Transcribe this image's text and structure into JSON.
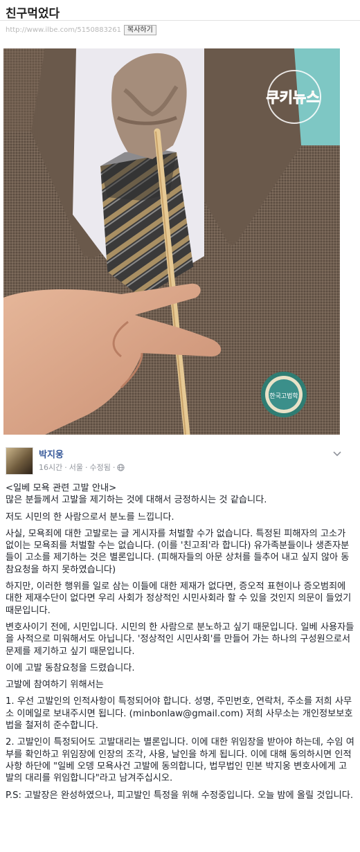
{
  "page": {
    "title": "친구먹었다",
    "url": "http://www.ilbe.com/5150883261",
    "copy_button": "복사하기"
  },
  "photo": {
    "alt": "",
    "watermark_text": "쿠키뉴스",
    "badge_text": "한국고법학"
  },
  "post": {
    "author": "박지웅",
    "time": "16시간",
    "location": "서울",
    "edited": "수정됨",
    "separator": "·",
    "paragraphs": [
      "<일베 모욕 관련 고발 안내>",
      "많은 분들께서 고발을 제기하는 것에 대해서 긍정하시는 것 같습니다.",
      "저도 시민의 한 사람으로서 분노를 느낍니다.",
      "사실, 모욕죄에 대한 고발로는 글 게시자를 처벌할 수가 없습니다. 특정된 피해자의 고소가 없이는 모욕죄를 처벌할 수는 없습니다. (이를 '친고죄'라 합니다) 유가족분들이나 생존자분들이 고소를 제기하는 것은 별론입니다. (피해자들의 아문 상처를 들추어 내고 싶지 않아 동참요청을 하지 못하였습니다)",
      "하지만, 이러한 행위를 일로 삼는 이들에 대한 제재가 없다면, 증오적 표현이나 증오범죄에 대한 제재수단이 없다면 우리 사회가 정상적인 시민사회라 할 수 있을 것인지 의문이 들었기 때문입니다.",
      "변호사이기 전에, 시민입니다. 시민의 한 사람으로 분노하고 싶기 때문입니다. 일베 사용자들을 사적으로 미워해서도 아닙니다. '정상적인 시민사회'를 만들어 가는 하나의 구성원으로서 문제를 제기하고 싶기 때문입니다.",
      "이에 고발 동참요청을 드렸습니다.",
      "고발에 참여하기 위해서는",
      "1. 우선 고발인의 인적사항이 특정되어야 합니다. 성명, 주민번호, 연락처, 주소를 저희 사무소 이메일로 보내주시면 됩니다. (minbonlaw@gmail.com) 저희 사무소는 개인정보보호법을 철저히 준수합니다.",
      "2. 고발인이 특정되어도 고발대리는 별론입니다. 이에 대한 위임장을 받아야 하는데, 수임 여부를 확인하고 위임장에 인장의 조각, 사용, 날인을 하게 됩니다. 이에 대해 동의하시면 인적사항 하단에 \"일베 오뎅 모욕사건 고발에 동의합니다, 법무법인 민본 박지웅 변호사에게 고발의 대리를 위임합니다\"라고 남겨주십시오.",
      "P.S: 고발장은 완성하였으나, 피고발인 특정을 위해 수정중입니다. 오늘 밤에 올릴 것입니다."
    ]
  },
  "colors": {
    "link": "#365899",
    "meta": "#90949c",
    "text": "#1d2129"
  },
  "icons": {
    "globe": "globe-icon",
    "chevron": "chevron-down-icon"
  }
}
